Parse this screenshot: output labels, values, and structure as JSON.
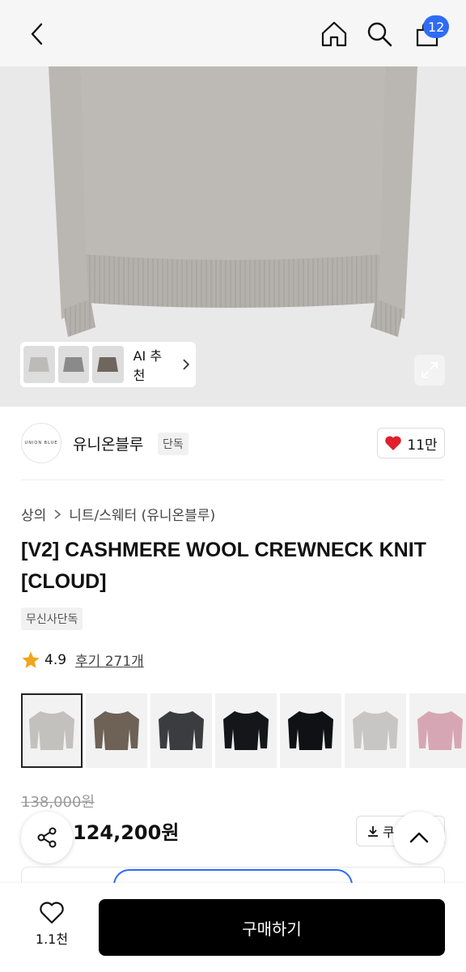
{
  "header": {
    "back_icon": "chevron-left-icon",
    "home_icon": "home-icon",
    "search_icon": "search-icon",
    "cart_icon": "shopping-bag-icon",
    "cart_count": "12",
    "accent": "#2f6cf6"
  },
  "hero": {
    "product_color": "#b9b6b1",
    "ai_recommend_label": "AI 추천",
    "ai_thumb_colors": [
      "#bdbbb8",
      "#8a8a8a",
      "#6f665d"
    ],
    "expand_icon": "expand-icon"
  },
  "brand": {
    "logo_text": "UNION BLUE",
    "name": "유니온블루",
    "tag": "단독",
    "likes": "11만",
    "like_color": "#e0202c"
  },
  "product": {
    "breadcrumb": [
      "상의",
      "니트/스웨터 (유니온블루)"
    ],
    "title": "[V2] CASHMERE WOOL CREWNECK KNIT [CLOUD]",
    "exclusive_tag": "무신사단독",
    "rating": "4.9",
    "reviews": "후기 271개",
    "star_color": "#f2a51a"
  },
  "swatches": [
    {
      "color": "#c3c1bd"
    },
    {
      "color": "#6e6155"
    },
    {
      "color": "#3a3c3f"
    },
    {
      "color": "#15161a"
    },
    {
      "color": "#101114"
    },
    {
      "color": "#c7c6c4"
    },
    {
      "color": "#d7a6b4"
    }
  ],
  "price": {
    "original": "138,000원",
    "sale": "124,200원",
    "coupon_label": "쿠폰"
  },
  "bottom": {
    "wish_count": "1.1천",
    "buy_label": "구매하기"
  }
}
